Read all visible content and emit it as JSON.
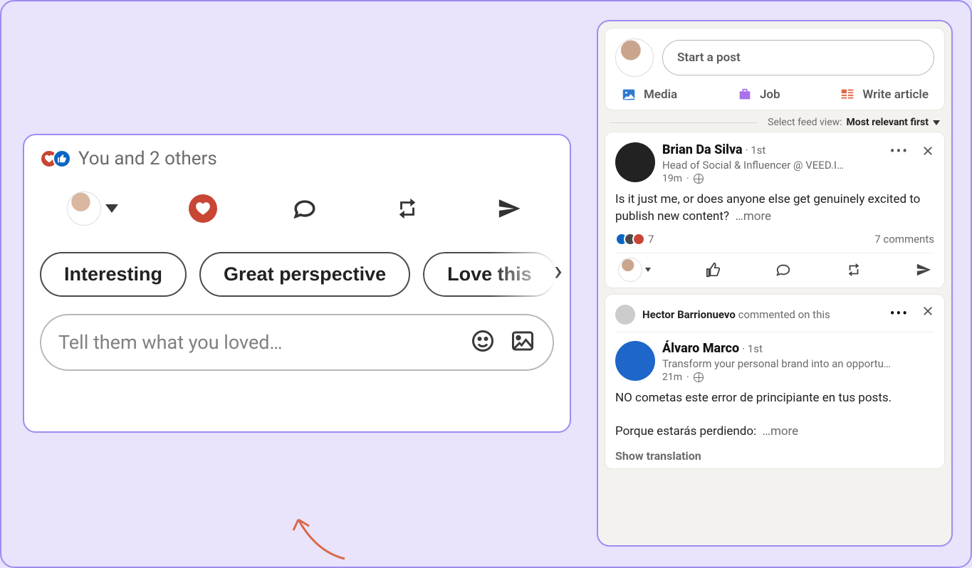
{
  "left": {
    "reactions_text": "You and 2 others",
    "suggestions": [
      "Interesting",
      "Great perspective",
      "Love this"
    ],
    "compose_placeholder": "Tell them what you loved…"
  },
  "composer": {
    "start_post": "Start a post",
    "media": "Media",
    "job": "Job",
    "write_article": "Write article"
  },
  "feed_filter": {
    "label": "Select feed view:",
    "value": "Most relevant first"
  },
  "post1": {
    "author": "Brian Da Silva",
    "connection": "1st",
    "byline": "Head of Social & Influencer @ VEED.I…",
    "timestamp": "19m",
    "body": "Is it just me, or does anyone else get genuinely excited to publish new content?",
    "more": "…more",
    "reaction_count": "7",
    "comments": "7 comments"
  },
  "post2": {
    "commenter": "Hector Barrionuevo",
    "commented_text": "commented on this",
    "author": "Álvaro Marco",
    "connection": "1st",
    "byline": "Transform your personal brand into an opportu…",
    "timestamp": "21m",
    "body_line1": "NO cometas este error de principiante en tus posts.",
    "body_line2": "Porque estarás perdiendo:",
    "more": "…more",
    "show_translation": "Show translation"
  },
  "icons": {
    "love": "love-icon",
    "like": "like-icon",
    "comment": "comment-icon",
    "repost": "repost-icon",
    "send": "send-icon",
    "emoji": "emoji-icon",
    "image": "image-icon",
    "media": "media-icon",
    "job": "job-icon",
    "article": "article-icon",
    "globe": "globe-icon"
  }
}
